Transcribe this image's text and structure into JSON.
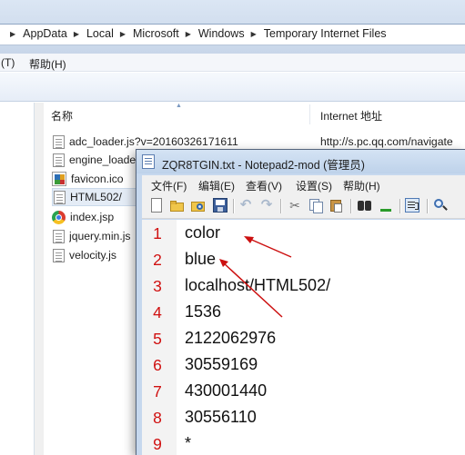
{
  "explorer": {
    "breadcrumbs": [
      "AppData",
      "Local",
      "Microsoft",
      "Windows",
      "Temporary Internet Files"
    ],
    "menu_partial_tools": "(T)",
    "menu_help": "帮助(H)",
    "columns": {
      "name": "名称",
      "internet_address": "Internet 地址"
    },
    "files": [
      {
        "name": "adc_loader.js?v=20160326171611",
        "address": "http://s.pc.qq.com/navigate",
        "icon": "doc-icon"
      },
      {
        "name": "engine_loader.js",
        "address": "",
        "icon": "doc-icon"
      },
      {
        "name": "favicon.ico",
        "address": "",
        "icon": "favicon-icon"
      },
      {
        "name": "HTML502/",
        "address": "",
        "icon": "doc-icon",
        "selected": true
      },
      {
        "name": "index.jsp",
        "address": "",
        "icon": "chrome-icon"
      },
      {
        "name": "jquery.min.js",
        "address": "",
        "icon": "doc-icon"
      },
      {
        "name": "velocity.js",
        "address": "",
        "icon": "doc-icon"
      }
    ]
  },
  "notepad": {
    "title": "ZQR8TGIN.txt - Notepad2-mod (管理员)",
    "menu": [
      "文件(F)",
      "编辑(E)",
      "查看(V)",
      "设置(S)",
      "帮助(H)"
    ],
    "toolbar_icons": [
      "new-icon",
      "open-icon",
      "browse-icon",
      "save-icon",
      "undo-icon",
      "redo-icon",
      "cut-icon",
      "copy-icon",
      "paste-icon",
      "find-icon",
      "replace-icon",
      "word-wrap-icon",
      "zoom-icon"
    ],
    "lines": [
      {
        "num": "1",
        "text": "color"
      },
      {
        "num": "2",
        "text": "blue"
      },
      {
        "num": "3",
        "text": "localhost/HTML502/"
      },
      {
        "num": "4",
        "text": "1536"
      },
      {
        "num": "5",
        "text": "2122062976"
      },
      {
        "num": "6",
        "text": "30559169"
      },
      {
        "num": "7",
        "text": "430001440"
      },
      {
        "num": "8",
        "text": "30556110"
      },
      {
        "num": "9",
        "text": "*"
      }
    ],
    "line_number_color": "#d01010",
    "annotation_arrow_color": "#cc1010"
  }
}
